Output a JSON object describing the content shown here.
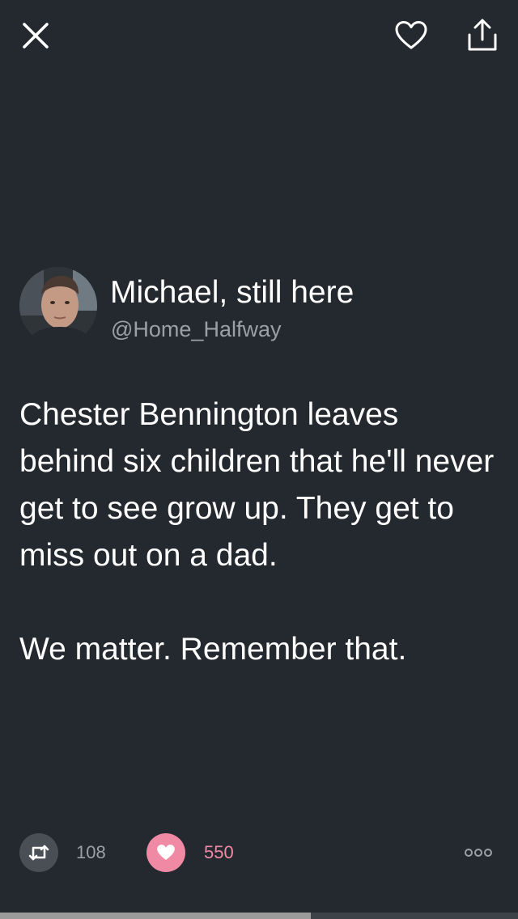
{
  "toolbar": {
    "close_icon": "close-icon",
    "like_icon": "heart-outline-icon",
    "share_icon": "share-icon"
  },
  "author": {
    "display_name": "Michael, still here",
    "handle": "@Home_Halfway"
  },
  "tweet": {
    "paragraphs": [
      "Chester Bennington leaves behind six children that he'll never get to see grow up. They get to miss out on a dad.",
      "We matter. Remember that."
    ]
  },
  "actions": {
    "retweet_count": "108",
    "like_count": "550",
    "retweet_icon": "retweet-icon",
    "like_icon": "heart-filled-icon",
    "more_icon": "more-options-icon"
  },
  "progress": {
    "fraction": 0.6
  },
  "colors": {
    "background": "#24292f",
    "like_accent": "#f08aa4",
    "muted_text": "#9aa0a6"
  }
}
